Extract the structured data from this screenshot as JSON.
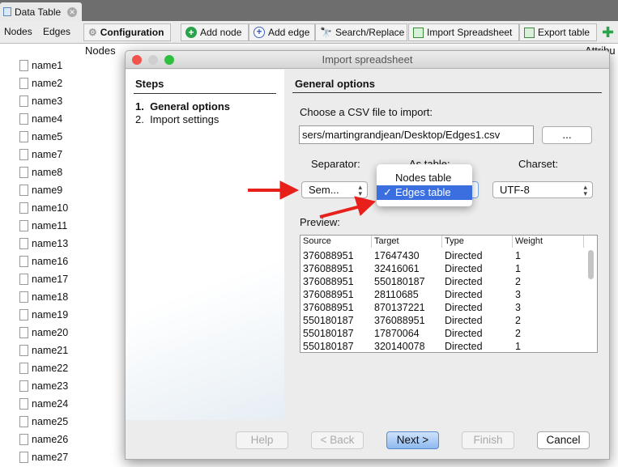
{
  "window_tab": {
    "label": "Data Table"
  },
  "toolbar": {
    "nodes": "Nodes",
    "edges": "Edges",
    "configuration": "Configuration",
    "add_node": "Add node",
    "add_edge": "Add edge",
    "search_replace": "Search/Replace",
    "import_spreadsheet": "Import Spreadsheet",
    "export_table": "Export table"
  },
  "table": {
    "col_nodes": "Nodes",
    "col_attributes": "Attribu",
    "rows": [
      "name1",
      "name2",
      "name3",
      "name4",
      "name5",
      "name7",
      "name8",
      "name9",
      "name10",
      "name11",
      "name13",
      "name16",
      "name17",
      "name18",
      "name19",
      "name20",
      "name21",
      "name22",
      "name23",
      "name24",
      "name25",
      "name26",
      "name27"
    ]
  },
  "dialog": {
    "title": "Import spreadsheet",
    "steps_title": "Steps",
    "steps": [
      "1.  General options",
      "2.  Import settings"
    ],
    "section_title": "General options",
    "choose_label": "Choose a CSV file to import:",
    "file_path": "sers/martingrandjean/Desktop/Edges1.csv",
    "browse": "...",
    "separator_label": "Separator:",
    "separator_value": "Sem...",
    "as_table_label": "As table:",
    "charset_label": "Charset:",
    "charset_value": "UTF-8",
    "as_table_options": [
      "Nodes table",
      "Edges table"
    ],
    "as_table_selected": "Edges table",
    "check": "✓",
    "preview_label": "Preview:",
    "preview_columns": [
      "Source",
      "Target",
      "Type",
      "Weight"
    ],
    "preview_rows": [
      [
        "376088951",
        "17647430",
        "Directed",
        "1"
      ],
      [
        "376088951",
        "32416061",
        "Directed",
        "1"
      ],
      [
        "376088951",
        "550180187",
        "Directed",
        "2"
      ],
      [
        "376088951",
        "28110685",
        "Directed",
        "3"
      ],
      [
        "376088951",
        "870137221",
        "Directed",
        "3"
      ],
      [
        "550180187",
        "376088951",
        "Directed",
        "2"
      ],
      [
        "550180187",
        "17870064",
        "Directed",
        "2"
      ],
      [
        "550180187",
        "320140078",
        "Directed",
        "1"
      ]
    ],
    "buttons": {
      "help": "Help",
      "back": "< Back",
      "next": "Next >",
      "finish": "Finish",
      "cancel": "Cancel"
    }
  },
  "colors": {
    "accent": "#3b6fe0",
    "arrow": "#e8201c"
  }
}
